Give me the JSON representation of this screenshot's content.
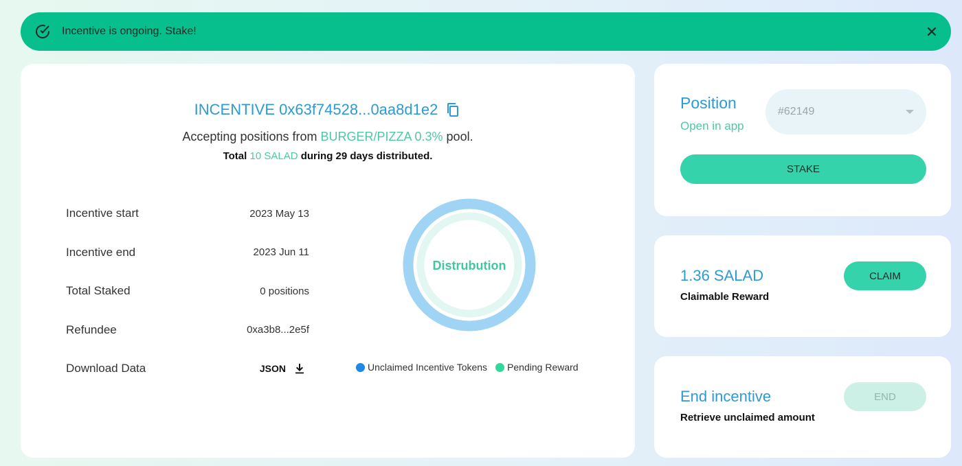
{
  "banner": {
    "message": "Incentive is ongoing. Stake!",
    "icon": "check-circle-icon",
    "close_icon": "close-icon",
    "color": "#06bf8c"
  },
  "incentive": {
    "title": "INCENTIVE 0x63f74528...0aa8d1e2",
    "copy_icon": "copy-icon",
    "accepting_prefix": "Accepting positions from ",
    "pool": "BURGER/PIZZA 0.3%",
    "accepting_suffix": " pool.",
    "total_prefix": "Total ",
    "total_amount": "10 SALAD",
    "total_suffix": " during 29 days distributed.",
    "details": [
      {
        "label": "Incentive start",
        "value": "2023 May 13"
      },
      {
        "label": "Incentive end",
        "value": "2023 Jun 11"
      },
      {
        "label": "Total Staked",
        "value": "0 positions"
      },
      {
        "label": "Refundee",
        "value": "0xa3b8...2e5f"
      }
    ],
    "download": {
      "label": "Download Data",
      "format": "JSON",
      "icon": "download-icon"
    }
  },
  "distribution": {
    "center_label": "Distrubution",
    "legend": [
      {
        "name": "Unclaimed Incentive Tokens",
        "color": "#1e88e5"
      },
      {
        "name": "Pending Reward",
        "color": "#2fd89b"
      }
    ]
  },
  "position": {
    "heading": "Position",
    "link": "Open in app",
    "selected": "#62149",
    "stake_label": "STAKE"
  },
  "claim": {
    "amount": "1.36 SALAD",
    "description": "Claimable Reward",
    "button": "CLAIM"
  },
  "end": {
    "heading": "End incentive",
    "description": "Retrieve unclaimed amount",
    "button": "END"
  }
}
